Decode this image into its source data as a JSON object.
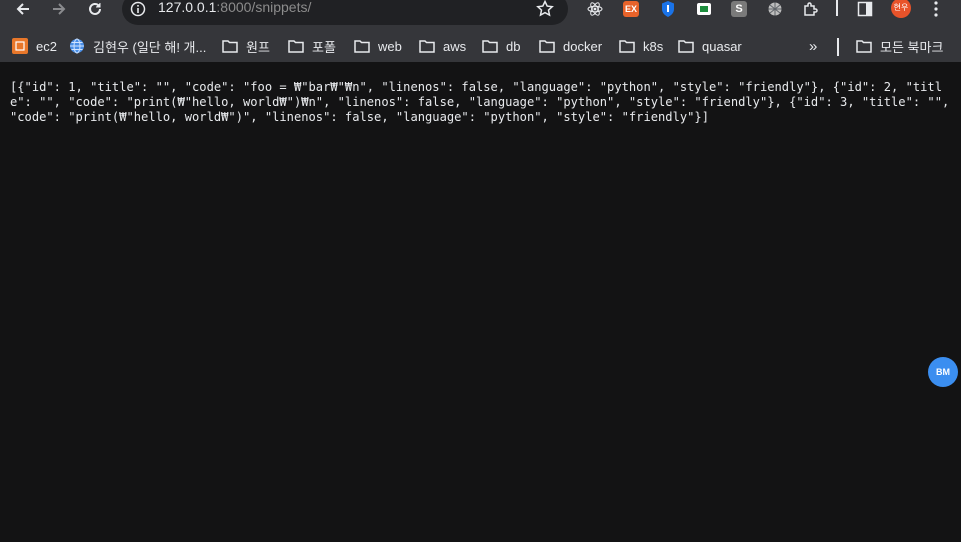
{
  "toolbar": {
    "url_host": "127.0.0.1",
    "url_rest": ":8000/snippets/",
    "extensions": [
      "react-icon",
      "ex-extension",
      "shield-extension",
      "sheets-extension",
      "s-extension",
      "spider-extension",
      "puzzle-icon"
    ],
    "avatar_label": "현우"
  },
  "bookmarks": {
    "items": [
      {
        "label": "ec2",
        "icon": "aws-icon"
      },
      {
        "label": "김현우 (일단 해! 개...",
        "icon": "globe-icon"
      },
      {
        "label": "원프",
        "icon": "folder-icon"
      },
      {
        "label": "포폴",
        "icon": "folder-icon"
      },
      {
        "label": "web",
        "icon": "folder-icon"
      },
      {
        "label": "aws",
        "icon": "folder-icon"
      },
      {
        "label": "db",
        "icon": "folder-icon"
      },
      {
        "label": "docker",
        "icon": "folder-icon"
      },
      {
        "label": "k8s",
        "icon": "folder-icon"
      },
      {
        "label": "quasar",
        "icon": "folder-icon"
      }
    ],
    "more": "»",
    "all_bookmarks": "모든 북마크"
  },
  "page": {
    "content": "[{\"id\": 1, \"title\": \"\", \"code\": \"foo = ₩\"bar₩\"₩n\", \"linenos\": false, \"language\": \"python\", \"style\": \"friendly\"}, {\"id\": 2, \"title\": \"\", \"code\": \"print(₩\"hello, world₩\")₩n\", \"linenos\": false, \"language\": \"python\", \"style\": \"friendly\"}, {\"id\": 3, \"title\": \"\", \"code\": \"print(₩\"hello, world₩\")\", \"linenos\": false, \"language\": \"python\", \"style\": \"friendly\"}]",
    "fab_label": "BM"
  }
}
